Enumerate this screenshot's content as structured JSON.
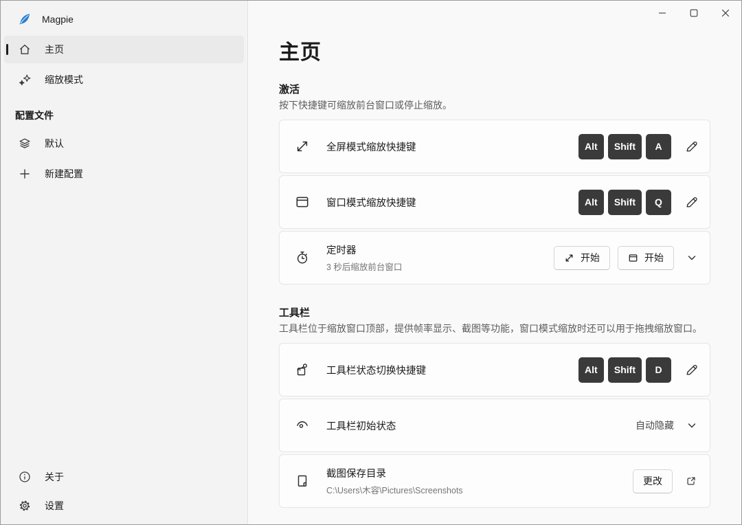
{
  "app": {
    "name": "Magpie",
    "logo_color": "#2a7fd0"
  },
  "sidebar": {
    "nav_items": [
      {
        "label": "主页",
        "icon": "home-icon",
        "selected": true
      },
      {
        "label": "缩放模式",
        "icon": "sparkles-icon",
        "selected": false
      }
    ],
    "profiles_header": "配置文件",
    "profile_items": [
      {
        "label": "默认",
        "icon": "layers-icon"
      },
      {
        "label": "新建配置",
        "icon": "plus-icon"
      }
    ],
    "footer_items": [
      {
        "label": "关于",
        "icon": "info-icon"
      },
      {
        "label": "设置",
        "icon": "gear-icon"
      }
    ]
  },
  "main": {
    "page_title": "主页",
    "sections": [
      {
        "title": "激活",
        "description": "按下快捷键可缩放前台窗口或停止缩放。",
        "cards": [
          {
            "icon": "resize-diagonal-icon",
            "label": "全屏模式缩放快捷键",
            "keys": [
              "Alt",
              "Shift",
              "A"
            ]
          },
          {
            "icon": "window-icon",
            "label": "窗口模式缩放快捷键",
            "keys": [
              "Alt",
              "Shift",
              "Q"
            ]
          },
          {
            "icon": "stopwatch-icon",
            "label": "定时器",
            "description": "3 秒后缩放前台窗口",
            "buttons": [
              {
                "icon": "resize-diagonal-icon",
                "label": "开始"
              },
              {
                "icon": "window-icon",
                "label": "开始"
              }
            ]
          }
        ]
      },
      {
        "title": "工具栏",
        "description": "工具栏位于缩放窗口顶部，提供帧率显示、截图等功能，窗口模式缩放时还可以用于拖拽缩放窗口。",
        "cards": [
          {
            "icon": "design-tools-icon",
            "label": "工具栏状态切换快捷键",
            "keys": [
              "Alt",
              "Shift",
              "D"
            ]
          },
          {
            "icon": "eye-icon",
            "label": "工具栏初始状态",
            "value": "自动隐藏"
          },
          {
            "icon": "image-file-icon",
            "label": "截图保存目录",
            "description": "C:\\Users\\木容\\Pictures\\Screenshots",
            "button_label": "更改"
          }
        ]
      }
    ]
  }
}
